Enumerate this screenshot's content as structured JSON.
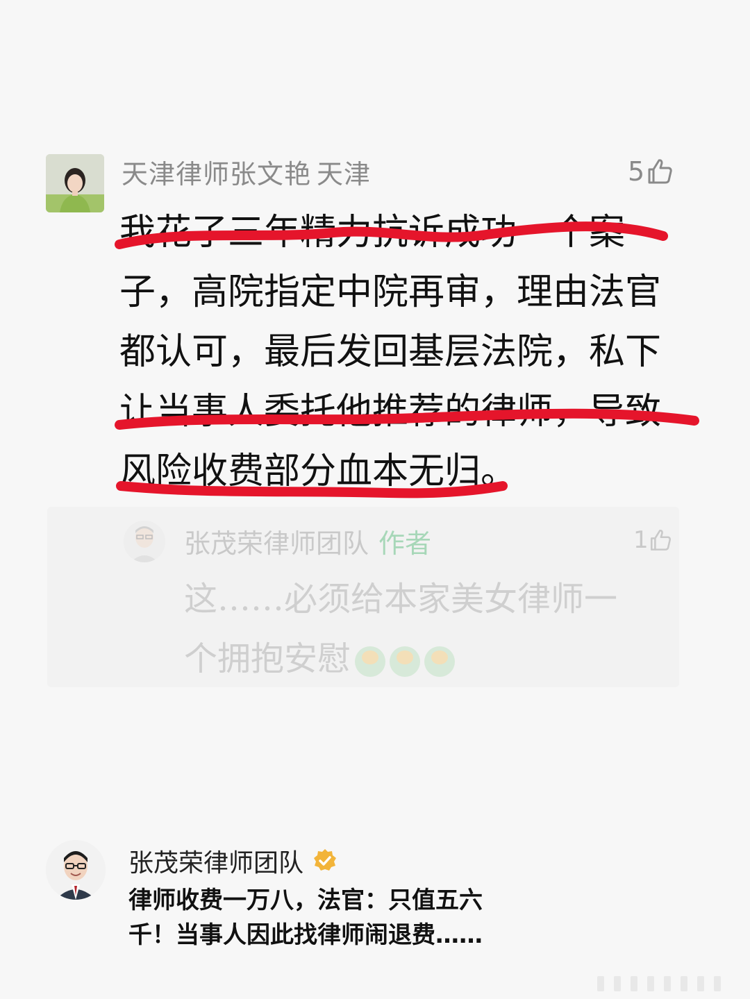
{
  "comment": {
    "author": "天津律师张文艳",
    "location": "天津",
    "likes": "5",
    "text_lines": [
      "我花了三年精力抗诉成功一个案",
      "子，高院指定中院再审，理由法官",
      "都认可，最后发回基层法院，私下",
      "让当事人委托他推荐的律师，导致",
      "风险收费部分血本无归。"
    ],
    "highlight_color": "#e5152b"
  },
  "reply": {
    "author": "张茂荣律师团队",
    "tag": "作者",
    "likes": "1",
    "text_lines": [
      "这……必须给本家美女律师一",
      "个拥抱安慰"
    ]
  },
  "card": {
    "author": "张茂荣律师团队",
    "verified_color": "#f2b43a",
    "text_lines": [
      "律师收费一万八，法官：只值五六",
      "千！当事人因此找律师闹退费……"
    ]
  }
}
